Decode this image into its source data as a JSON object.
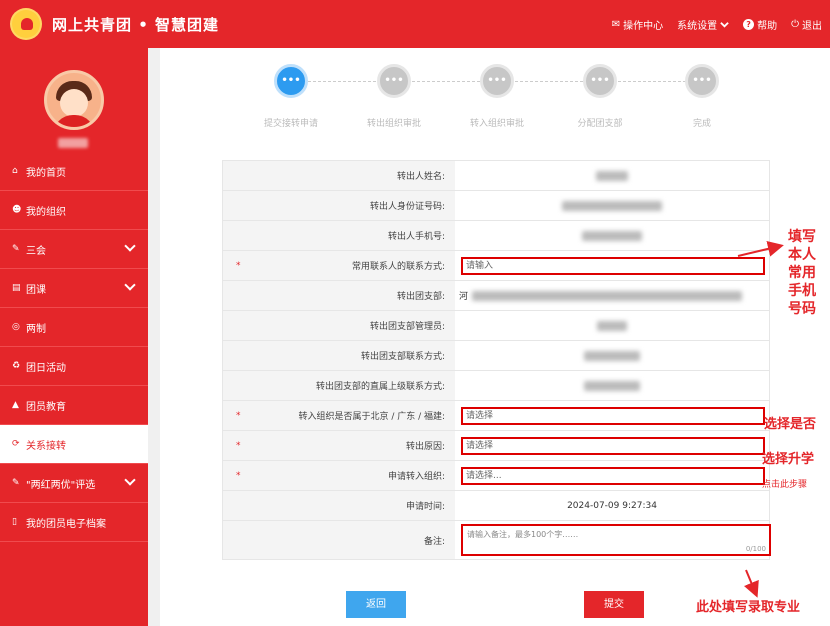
{
  "header": {
    "title": "网上共青团 • 智慧团建",
    "actions": [
      {
        "icon": "envelope-icon",
        "glyph": "✉",
        "label": "操作中心"
      },
      {
        "icon": "chevron-down-icon",
        "glyph": "",
        "label": "系统设置"
      },
      {
        "icon": "help-icon",
        "glyph": "?",
        "label": "帮助"
      },
      {
        "icon": "power-icon",
        "glyph": "⏻",
        "label": "退出"
      }
    ]
  },
  "sidebar": {
    "items": [
      {
        "icon": "home-icon",
        "glyph": "⌂",
        "label": "我的首页"
      },
      {
        "icon": "users-icon",
        "glyph": "☻",
        "label": "我的组织"
      },
      {
        "icon": "edit-icon",
        "glyph": "✎",
        "label": "三会"
      },
      {
        "icon": "folder-icon",
        "glyph": "▤",
        "label": "团课"
      },
      {
        "icon": "target-icon",
        "glyph": "◎",
        "label": "两制"
      },
      {
        "icon": "recycle-icon",
        "glyph": "♻",
        "label": "团日活动"
      },
      {
        "icon": "graduation-cap-icon",
        "glyph": "▲",
        "label": "团员教育"
      },
      {
        "icon": "refresh-icon",
        "glyph": "⟳",
        "label": "关系接转"
      },
      {
        "icon": "edit-icon",
        "glyph": "✎",
        "label": "\"两红两优\"评选"
      },
      {
        "icon": "document-icon",
        "glyph": "▯",
        "label": "我的团员电子档案"
      }
    ]
  },
  "steps": [
    {
      "label": "提交接转申请",
      "dots": "•••"
    },
    {
      "label": "转出组织审批",
      "dots": "•••"
    },
    {
      "label": "转入组织审批",
      "dots": "•••"
    },
    {
      "label": "分配团支部",
      "dots": "•••"
    },
    {
      "label": "完成",
      "dots": "•••"
    }
  ],
  "form": {
    "name_label": "转出人姓名:",
    "id_label": "转出人身份证号码:",
    "phone_label": "转出人手机号:",
    "contact_label": "常用联系人的联系方式:",
    "contact_placeholder": "请输入",
    "branch_label": "转出团支部:",
    "branch_prefix": "河",
    "admin_label": "转出团支部管理员:",
    "branch_contact_label": "转出团支部联系方式:",
    "superior_contact_label": "转出团支部的直属上级联系方式:",
    "region_label": "转入组织是否属于北京 / 广东 / 福建:",
    "region_placeholder": "请选择",
    "reason_label": "转出原因:",
    "reason_placeholder": "请选择",
    "target_label": "申请转入组织:",
    "target_placeholder": "请选择...",
    "time_label": "申请时间:",
    "time_value": "2024-07-09 9:27:34",
    "remark_label": "备注:",
    "remark_placeholder": "请输入备注，最多100个字……",
    "remark_counter": "0/100",
    "required_mark": "*"
  },
  "buttons": {
    "back": "返回",
    "submit": "提交"
  },
  "annotations": {
    "phone_note": "填写\n本人\n常用\n手机\n号码",
    "select_no": "选择是否",
    "select_graduate": "选择升学",
    "click_step": "点击此步骤",
    "major_note": "此处填写录取专业"
  },
  "colors": {
    "brand": "#e4262a",
    "active_step": "#2d9bf0",
    "back_button": "#3fa6ee"
  }
}
